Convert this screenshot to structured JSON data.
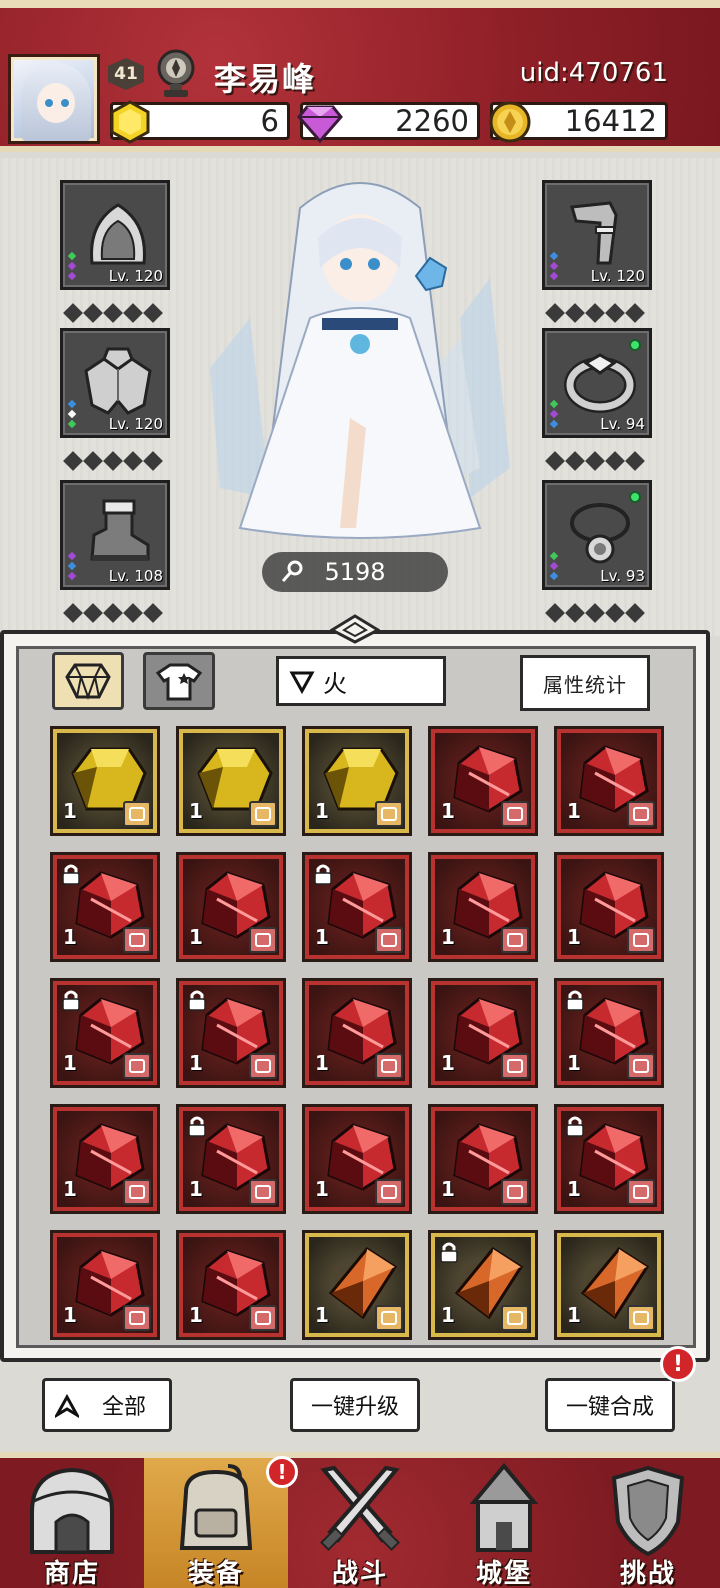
{
  "player": {
    "level": "41",
    "name": "李易峰",
    "uid": "uid:470761"
  },
  "resources": {
    "gold": "6",
    "gems": "2260",
    "coins": "16412"
  },
  "equipment": {
    "left": [
      {
        "id": "helmet",
        "icon": "hood-icon",
        "level": "Lv. 120",
        "pips": [
          "#3ec95a",
          "#a24ad6",
          "#a24ad6"
        ]
      },
      {
        "id": "armor",
        "icon": "cloak-icon",
        "level": "Lv. 120",
        "pips": [
          "#3c8fe0",
          "#ffffff",
          "#3ec95a"
        ]
      },
      {
        "id": "boots",
        "icon": "boot-icon",
        "level": "Lv. 108",
        "pips": [
          "#a24ad6",
          "#3c8fe0",
          "#a24ad6"
        ]
      }
    ],
    "right": [
      {
        "id": "weapon",
        "icon": "pipe-icon",
        "level": "Lv. 120",
        "pips": [
          "#3c8fe0",
          "#a24ad6",
          "#a24ad6"
        ],
        "dot": false
      },
      {
        "id": "ring",
        "icon": "ring-icon",
        "level": "Lv. 94",
        "pips": [
          "#3ec95a",
          "#a24ad6",
          "#3c8fe0"
        ],
        "dot": true
      },
      {
        "id": "necklace",
        "icon": "necklace-icon",
        "level": "Lv. 93",
        "pips": [
          "#3ec95a",
          "#a24ad6",
          "#3c8fe0"
        ],
        "dot": true
      }
    ]
  },
  "power": "5198",
  "filter": {
    "element": "火"
  },
  "buttons": {
    "stats": "属性统计",
    "all": "全部",
    "upgrade": "一键升级",
    "merge": "一键合成"
  },
  "alerts": {
    "merge": "!",
    "equip": "!"
  },
  "inventory": [
    {
      "color": "gold",
      "count": "1",
      "lock": false
    },
    {
      "color": "gold",
      "count": "1",
      "lock": false
    },
    {
      "color": "gold",
      "count": "1",
      "lock": false
    },
    {
      "color": "red",
      "count": "1",
      "lock": false
    },
    {
      "color": "red",
      "count": "1",
      "lock": false
    },
    {
      "color": "red",
      "count": "1",
      "lock": true
    },
    {
      "color": "red",
      "count": "1",
      "lock": false
    },
    {
      "color": "red",
      "count": "1",
      "lock": true
    },
    {
      "color": "red",
      "count": "1",
      "lock": false
    },
    {
      "color": "red",
      "count": "1",
      "lock": false
    },
    {
      "color": "red",
      "count": "1",
      "lock": true
    },
    {
      "color": "red",
      "count": "1",
      "lock": true
    },
    {
      "color": "red",
      "count": "1",
      "lock": false
    },
    {
      "color": "red",
      "count": "1",
      "lock": false
    },
    {
      "color": "red",
      "count": "1",
      "lock": true
    },
    {
      "color": "red",
      "count": "1",
      "lock": false
    },
    {
      "color": "red",
      "count": "1",
      "lock": true
    },
    {
      "color": "red",
      "count": "1",
      "lock": false
    },
    {
      "color": "red",
      "count": "1",
      "lock": false
    },
    {
      "color": "red",
      "count": "1",
      "lock": true
    },
    {
      "color": "red",
      "count": "1",
      "lock": false
    },
    {
      "color": "red",
      "count": "1",
      "lock": false
    },
    {
      "color": "orange",
      "count": "1",
      "lock": false
    },
    {
      "color": "orange",
      "count": "1",
      "lock": true
    },
    {
      "color": "orange",
      "count": "1",
      "lock": false
    }
  ],
  "nav": [
    {
      "label": "商店",
      "icon": "shop-icon",
      "active": false
    },
    {
      "label": "装备",
      "icon": "backpack-icon",
      "active": true
    },
    {
      "label": "战斗",
      "icon": "crossed-swords-icon",
      "active": false
    },
    {
      "label": "城堡",
      "icon": "castle-icon",
      "active": false
    },
    {
      "label": "挑战",
      "icon": "shield-icon",
      "active": false
    }
  ]
}
